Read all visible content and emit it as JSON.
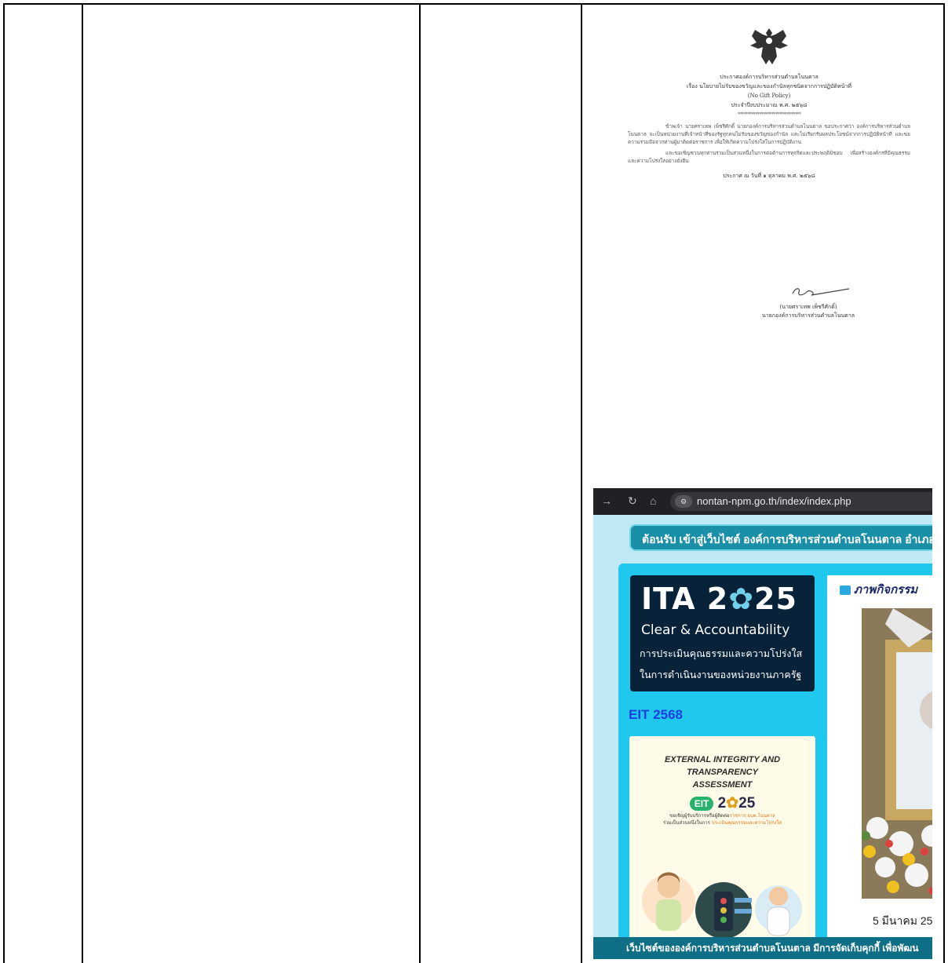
{
  "announcement": {
    "header_lines": [
      "ประกาศองค์การบริหารส่วนตำบลโนนตาล",
      "เรื่อง นโยบายไม่รับของขวัญและของกำนัลทุกชนิดจากการปฏิบัติหน้าที่",
      "(No Gift Policy)",
      "ประจำปีงบประมาณ พ.ศ. ๒๕๖๘"
    ],
    "divider": "********************************",
    "paragraphs": [
      "ข้าพเจ้า นายศราเทพ เพ็ชรีศักดิ์ นายกองค์การบริหารส่วนตำบลโนนตาล ขอประกาศว่า องค์การบริหารส่วนตำบลโนนตาล จะเป็นหน่วยงานที่เจ้าหน้าที่ของรัฐทุกคนไม่รับของขวัญของกำนัล และไม่เรียกรับผลประโยชน์จากการปฏิบัติหน้าที่ และขอความร่วมมือจากท่านผู้มาติดต่อราชการ เพื่อให้เกิดความโปร่งใสในการปฏิบัติงาน",
      "และขอเชิญชวนทุกท่านร่วมเป็นส่วนหนึ่งในการต่อต้านการทุจริตและประพฤติมิชอบ เพื่อสร้างองค์กรที่มีคุณธรรมและความโปร่งใสอย่างยั่งยืน"
    ],
    "issued": "ประกาศ ณ วันที่ ๑ ตุลาคม พ.ศ. ๒๕๖๘",
    "signer_name": "(นายศราเทพ เพ็ชรีศักดิ์)",
    "signer_title": "นายกองค์การบริหารส่วนตำบลโนนตาล"
  },
  "screenshot": {
    "url": "nontan-npm.go.th/index/index.php",
    "welcome": "ต้อนรับ เข้าสู่เว็บไซต์ องค์การบริหารส่วนตำบลโนนตาล อำเภอท่",
    "ita": {
      "big_a": "ITA 2",
      "big_b": "25",
      "sub": "Clear & Accountability",
      "th1": "การประเมินคุณธรรมและความโปร่งใส",
      "th2": "ในการดำเนินงานของหน่วยงานภาครัฐ"
    },
    "eit_title": "EIT 2568",
    "eit_card": {
      "heading1": "EXTERNAL INTEGRITY AND TRANSPARENCY",
      "heading2": "ASSESSMENT",
      "badge": "EIT",
      "year_a": "2",
      "year_b": "25",
      "line1_a": "ขอเชิญผู้รับบริการหรือผู้ติดต่อ",
      "line1_b": "ราชการ อบต.โนนตาล",
      "line2_a": "ร่วมเป็นส่วนหนึ่งในการ ",
      "line2_b": "ประเมินคุณธรรมและความโปร่งใส"
    },
    "activity_title": "ภาพกิจกรรม",
    "activity_date": "5 มีนาคม 25",
    "cookie_bar": "เว็บไซต์ขององค์การบริหารส่วนตำบลโนนตาล มีการจัดเก็บคุกกี้ เพื่อพัฒน"
  }
}
